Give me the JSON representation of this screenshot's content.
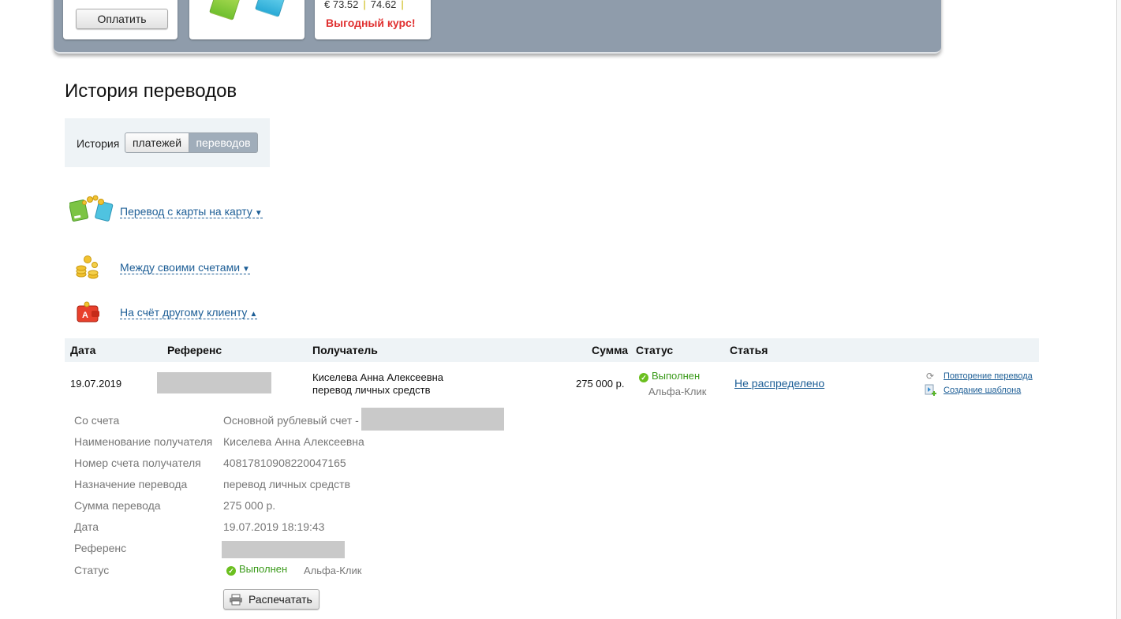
{
  "banner": {
    "pay_label": "Оплатить",
    "rate_text": "€ 73.52",
    "rate_sell": "74.62",
    "rate_promo": "Выгодный курс!"
  },
  "page": {
    "title": "История переводов"
  },
  "toggle": {
    "label": "История",
    "options": [
      "платежей",
      "переводов"
    ],
    "selected": "переводов"
  },
  "sections": [
    {
      "label": "Перевод с карты на карту",
      "arrow": "▼",
      "icon": "cards-icon"
    },
    {
      "label": "Между своими счетами",
      "arrow": "▼",
      "icon": "coins-icon"
    },
    {
      "label": "На счёт другому клиенту",
      "arrow": "▲",
      "icon": "wallet-icon"
    }
  ],
  "table": {
    "headers": {
      "date": "Дата",
      "ref": "Референс",
      "recipient": "Получатель",
      "sum": "Сумма",
      "status": "Статус",
      "category": "Статья"
    },
    "rows": [
      {
        "date": "19.07.2019",
        "recipient_name": "Киселева Анна Алексеевна",
        "recipient_note": "перевод личных средств",
        "sum": "275 000  р.",
        "status": "Выполнен",
        "channel": "Альфа-Клик",
        "category": "Не распределено",
        "action_repeat": "Повторение перевода",
        "action_template": "Создание шаблона"
      }
    ]
  },
  "details": {
    "labels": {
      "from": "Со счета",
      "name": "Наименование получателя",
      "account": "Номер счета получателя",
      "purpose": "Назначение перевода",
      "amount": "Сумма перевода",
      "date": "Дата",
      "ref": "Референс",
      "status": "Статус"
    },
    "values": {
      "from": "Основной рублевый счет -",
      "name": "Киселева Анна Алексеевна",
      "account": "40817810908220047165",
      "purpose": "перевод личных средств",
      "amount": "275 000 р.",
      "date": "19.07.2019 18:19:43",
      "status": "Выполнен",
      "channel": "Альфа-Клик"
    },
    "print_label": "Распечатать"
  },
  "colors": {
    "link": "#1d5e96",
    "success": "#3a9a1a",
    "banner": "#8f9cab",
    "promo": "#e03030"
  }
}
